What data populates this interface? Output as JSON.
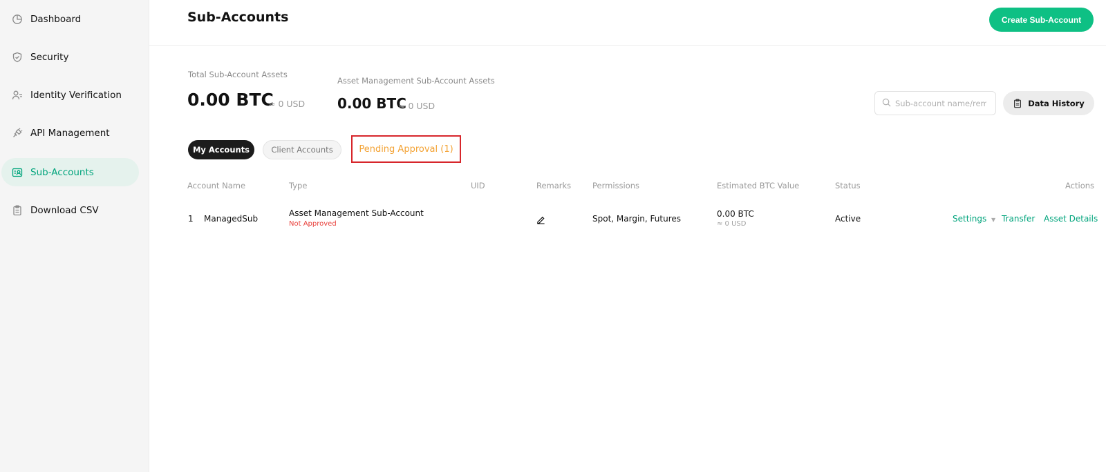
{
  "colors": {
    "accent": "#0ec084",
    "accent_text": "#00a47c",
    "pending": "#f3a233",
    "not_approved": "#e8403b",
    "highlight_box": "#d7262b"
  },
  "sidebar": {
    "items": [
      {
        "label": "Dashboard",
        "icon": "pie-chart-icon"
      },
      {
        "label": "Security",
        "icon": "shield-icon"
      },
      {
        "label": "Identity Verification",
        "icon": "user-id-icon"
      },
      {
        "label": "API Management",
        "icon": "api-plug-icon"
      },
      {
        "label": "Sub-Accounts",
        "icon": "sub-accounts-icon",
        "active": true
      },
      {
        "label": "Download CSV",
        "icon": "clipboard-icon"
      }
    ]
  },
  "header": {
    "title": "Sub-Accounts",
    "create_label": "Create Sub-Account"
  },
  "assets": {
    "total_label": "Total Sub-Account Assets",
    "total_value": "0.00 BTC",
    "total_usd": "≈ 0 USD",
    "am_label": "Asset Management Sub-Account Assets",
    "am_value": "0.00 BTC",
    "am_usd": "≈ 0 USD"
  },
  "search": {
    "placeholder": "Sub-account name/remarks"
  },
  "history_label": "Data History",
  "tabs": [
    {
      "label": "My Accounts",
      "active": true
    },
    {
      "label": "Client Accounts"
    },
    {
      "label": "Pending Approval (1)"
    }
  ],
  "table": {
    "columns": [
      "Account Name",
      "Type",
      "UID",
      "Remarks",
      "Permissions",
      "Estimated BTC Value",
      "Status",
      "Actions"
    ],
    "rows": [
      {
        "index": "1",
        "name": "ManagedSub",
        "type": "Asset Management Sub-Account",
        "type_status": "Not Approved",
        "uid": "",
        "remarks_icon": "edit-pencil-icon",
        "permissions": "Spot, Margin, Futures",
        "btc": "0.00 BTC",
        "usd": "≈ 0 USD",
        "status": "Active",
        "actions": {
          "settings": "Settings",
          "transfer": "Transfer",
          "details": "Asset Details"
        }
      }
    ]
  }
}
